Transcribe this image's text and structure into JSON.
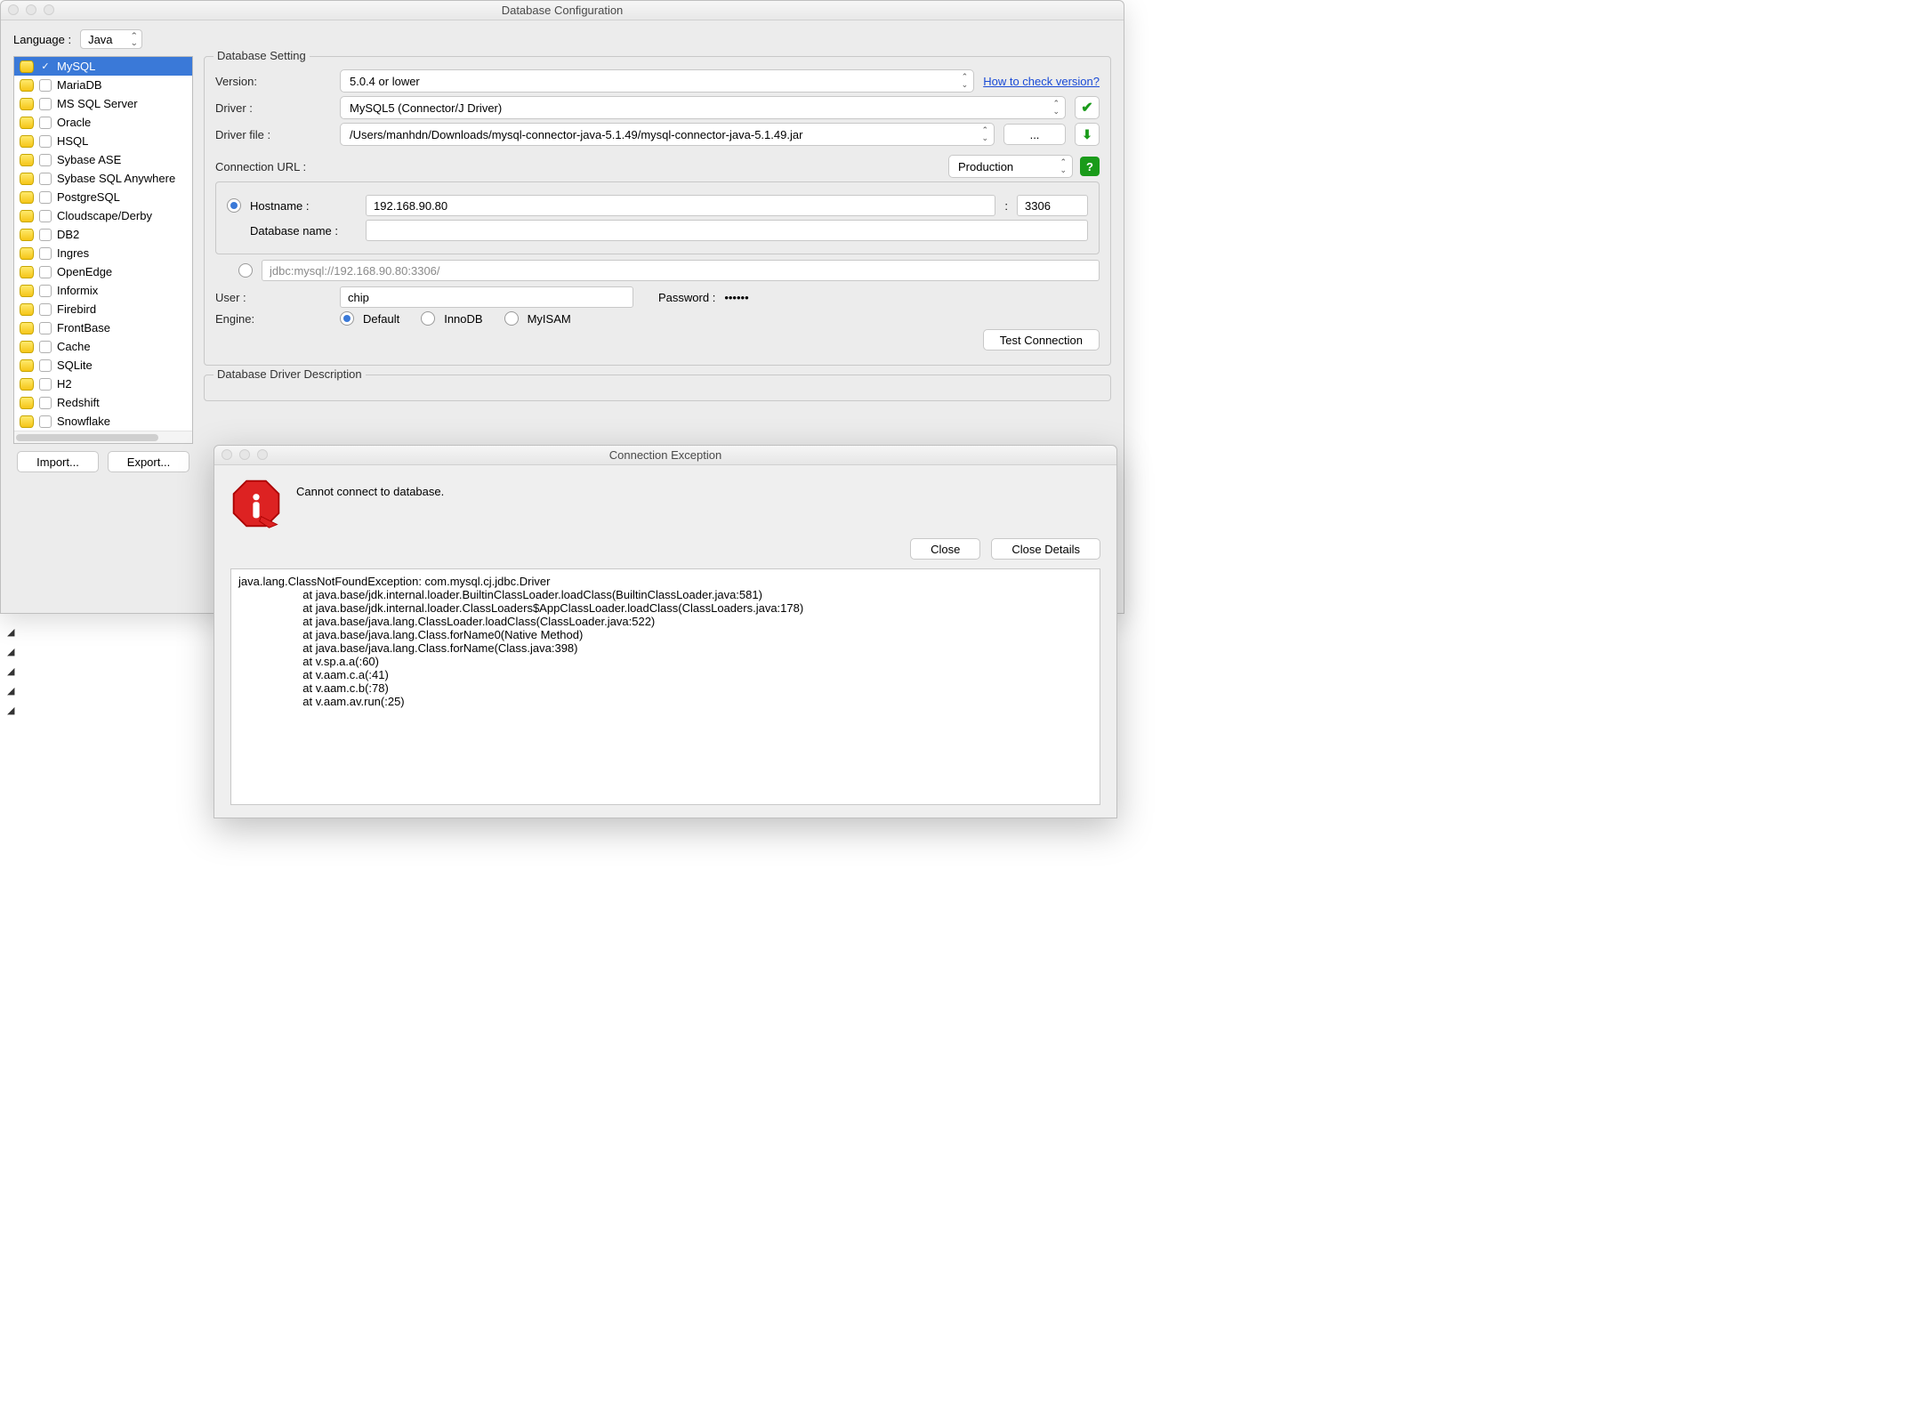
{
  "window": {
    "title": "Database Configuration",
    "language_label": "Language :",
    "language_value": "Java",
    "import_btn": "Import...",
    "export_btn": "Export..."
  },
  "db_list": [
    {
      "name": "MySQL",
      "checked": true,
      "selected": true
    },
    {
      "name": "MariaDB"
    },
    {
      "name": "MS SQL Server"
    },
    {
      "name": "Oracle"
    },
    {
      "name": "HSQL"
    },
    {
      "name": "Sybase ASE"
    },
    {
      "name": "Sybase SQL Anywhere"
    },
    {
      "name": "PostgreSQL"
    },
    {
      "name": "Cloudscape/Derby"
    },
    {
      "name": "DB2"
    },
    {
      "name": "Ingres"
    },
    {
      "name": "OpenEdge"
    },
    {
      "name": "Informix"
    },
    {
      "name": "Firebird"
    },
    {
      "name": "FrontBase"
    },
    {
      "name": "Cache"
    },
    {
      "name": "SQLite"
    },
    {
      "name": "H2"
    },
    {
      "name": "Redshift"
    },
    {
      "name": "Snowflake"
    }
  ],
  "settings": {
    "legend": "Database Setting",
    "version_label": "Version:",
    "version_value": "5.0.4 or lower",
    "version_link": "How to check version?",
    "driver_label": "Driver :",
    "driver_value": "MySQL5 (Connector/J Driver)",
    "driver_file_label": "Driver file :",
    "driver_file_value": "/Users/manhdn/Downloads/mysql-connector-java-5.1.49/mysql-connector-java-5.1.49.jar",
    "browse_btn": "...",
    "conn_url_label": "Connection URL :",
    "profile_value": "Production",
    "hostname_label": "Hostname :",
    "hostname_value": "192.168.90.80",
    "port_sep": ":",
    "port_value": "3306",
    "dbname_label": "Database name :",
    "dbname_value": "",
    "jdbc_url": "jdbc:mysql://192.168.90.80:3306/",
    "user_label": "User :",
    "user_value": "chip",
    "password_label": "Password :",
    "password_value": "••••••",
    "engine_label": "Engine:",
    "engine_options": [
      "Default",
      "InnoDB",
      "MyISAM"
    ],
    "engine_selected": "Default",
    "test_btn": "Test Connection",
    "driver_desc_legend": "Database Driver Description"
  },
  "dialog": {
    "title": "Connection Exception",
    "message": "Cannot connect to database.",
    "close_btn": "Close",
    "close_details_btn": "Close Details",
    "stack": "java.lang.ClassNotFoundException: com.mysql.cj.jdbc.Driver\n                    at java.base/jdk.internal.loader.BuiltinClassLoader.loadClass(BuiltinClassLoader.java:581)\n                    at java.base/jdk.internal.loader.ClassLoaders$AppClassLoader.loadClass(ClassLoaders.java:178)\n                    at java.base/java.lang.ClassLoader.loadClass(ClassLoader.java:522)\n                    at java.base/java.lang.Class.forName0(Native Method)\n                    at java.base/java.lang.Class.forName(Class.java:398)\n                    at v.sp.a.a(:60)\n                    at v.aam.c.a(:41)\n                    at v.aam.c.b(:78)\n                    at v.aam.av.run(:25)"
  }
}
